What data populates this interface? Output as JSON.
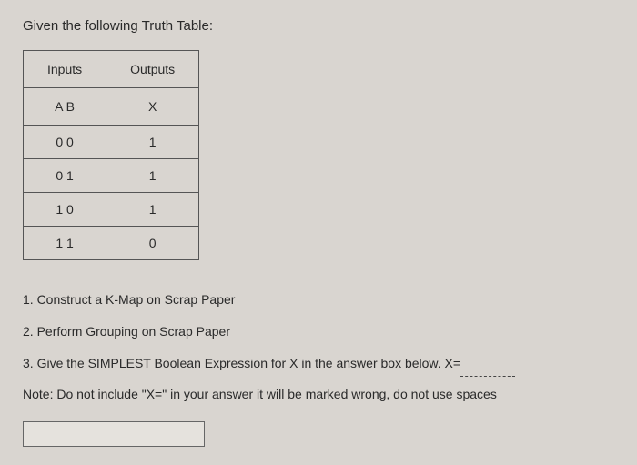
{
  "title": "Given the following Truth Table:",
  "table": {
    "header1": {
      "col1": "Inputs",
      "col2": "Outputs"
    },
    "header2": {
      "col1": "A B",
      "col2": "X"
    },
    "rows": [
      {
        "input": "0 0",
        "output": "1"
      },
      {
        "input": "0 1",
        "output": "1"
      },
      {
        "input": "1 0",
        "output": "1"
      },
      {
        "input": "1 1",
        "output": "0"
      }
    ]
  },
  "instructions": {
    "step1": "1. Construct a K-Map on Scrap Paper",
    "step2": "2. Perform Grouping on Scrap Paper",
    "step3": "3. Give the SIMPLEST Boolean Expression for X in the answer box below.  X=",
    "note": "Note: Do not include \"X=\" in your answer it will be marked wrong, do not use spaces"
  },
  "chart_data": {
    "type": "table",
    "title": "Truth Table",
    "columns": [
      "A",
      "B",
      "X"
    ],
    "rows": [
      [
        0,
        0,
        1
      ],
      [
        0,
        1,
        1
      ],
      [
        1,
        0,
        1
      ],
      [
        1,
        1,
        0
      ]
    ]
  }
}
